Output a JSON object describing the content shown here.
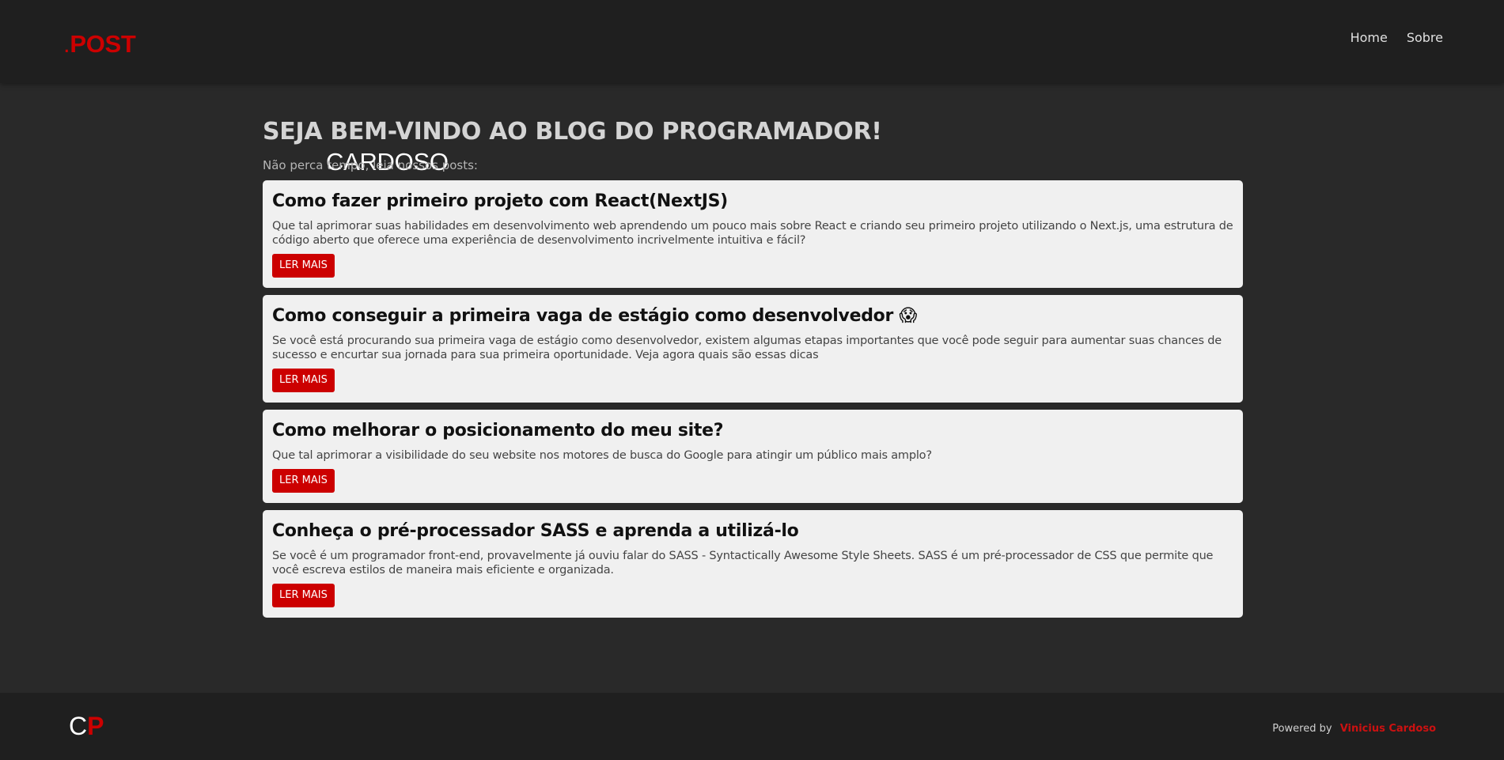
{
  "header": {
    "logo_dot": ".",
    "logo_main": "CARDOSO",
    "logo_accent": "POST",
    "nav": [
      {
        "label": "Home"
      },
      {
        "label": "Sobre"
      }
    ]
  },
  "main": {
    "title": "SEJA BEM-VINDO AO BLOG DO PROGRAMADOR!",
    "subtitle": "Não perca tempo, leia nossos posts:",
    "posts": [
      {
        "title": "Como fazer primeiro projeto com React(NextJS)",
        "description": "Que tal aprimorar suas habilidades em desenvolvimento web aprendendo um pouco mais sobre React e criando seu primeiro projeto utilizando o Next.js, uma estrutura de código aberto que oferece uma experiência de desenvolvimento incrivelmente intuitiva e fácil?",
        "button": "LER MAIS"
      },
      {
        "title": "Como conseguir a primeira vaga de estágio como desenvolvedor 😱",
        "description": "Se você está procurando sua primeira vaga de estágio como desenvolvedor, existem algumas etapas importantes que você pode seguir para aumentar suas chances de sucesso e encurtar sua jornada para sua primeira oportunidade. Veja agora quais são essas dicas",
        "button": "LER MAIS"
      },
      {
        "title": "Como melhorar o posicionamento do meu site?",
        "description": "Que tal aprimorar a visibilidade do seu website nos motores de busca do Google para atingir um público mais amplo?",
        "button": "LER MAIS"
      },
      {
        "title": "Conheça o pré-processador SASS e aprenda a utilizá-lo",
        "description": "Se você é um programador front-end, provavelmente já ouviu falar do SASS - Syntactically Awesome Style Sheets. SASS é um pré-processador de CSS que permite que você escreva estilos de maneira mais eficiente e organizada.",
        "button": "LER MAIS"
      }
    ]
  },
  "footer": {
    "logo_c": "C",
    "logo_p": "P",
    "powered_label": "Powered by",
    "author": "Vinicius Cardoso"
  },
  "colors": {
    "background": "#292929",
    "header": "#1f1f1f",
    "accent": "#cc0000",
    "card": "#f0f0f0"
  }
}
